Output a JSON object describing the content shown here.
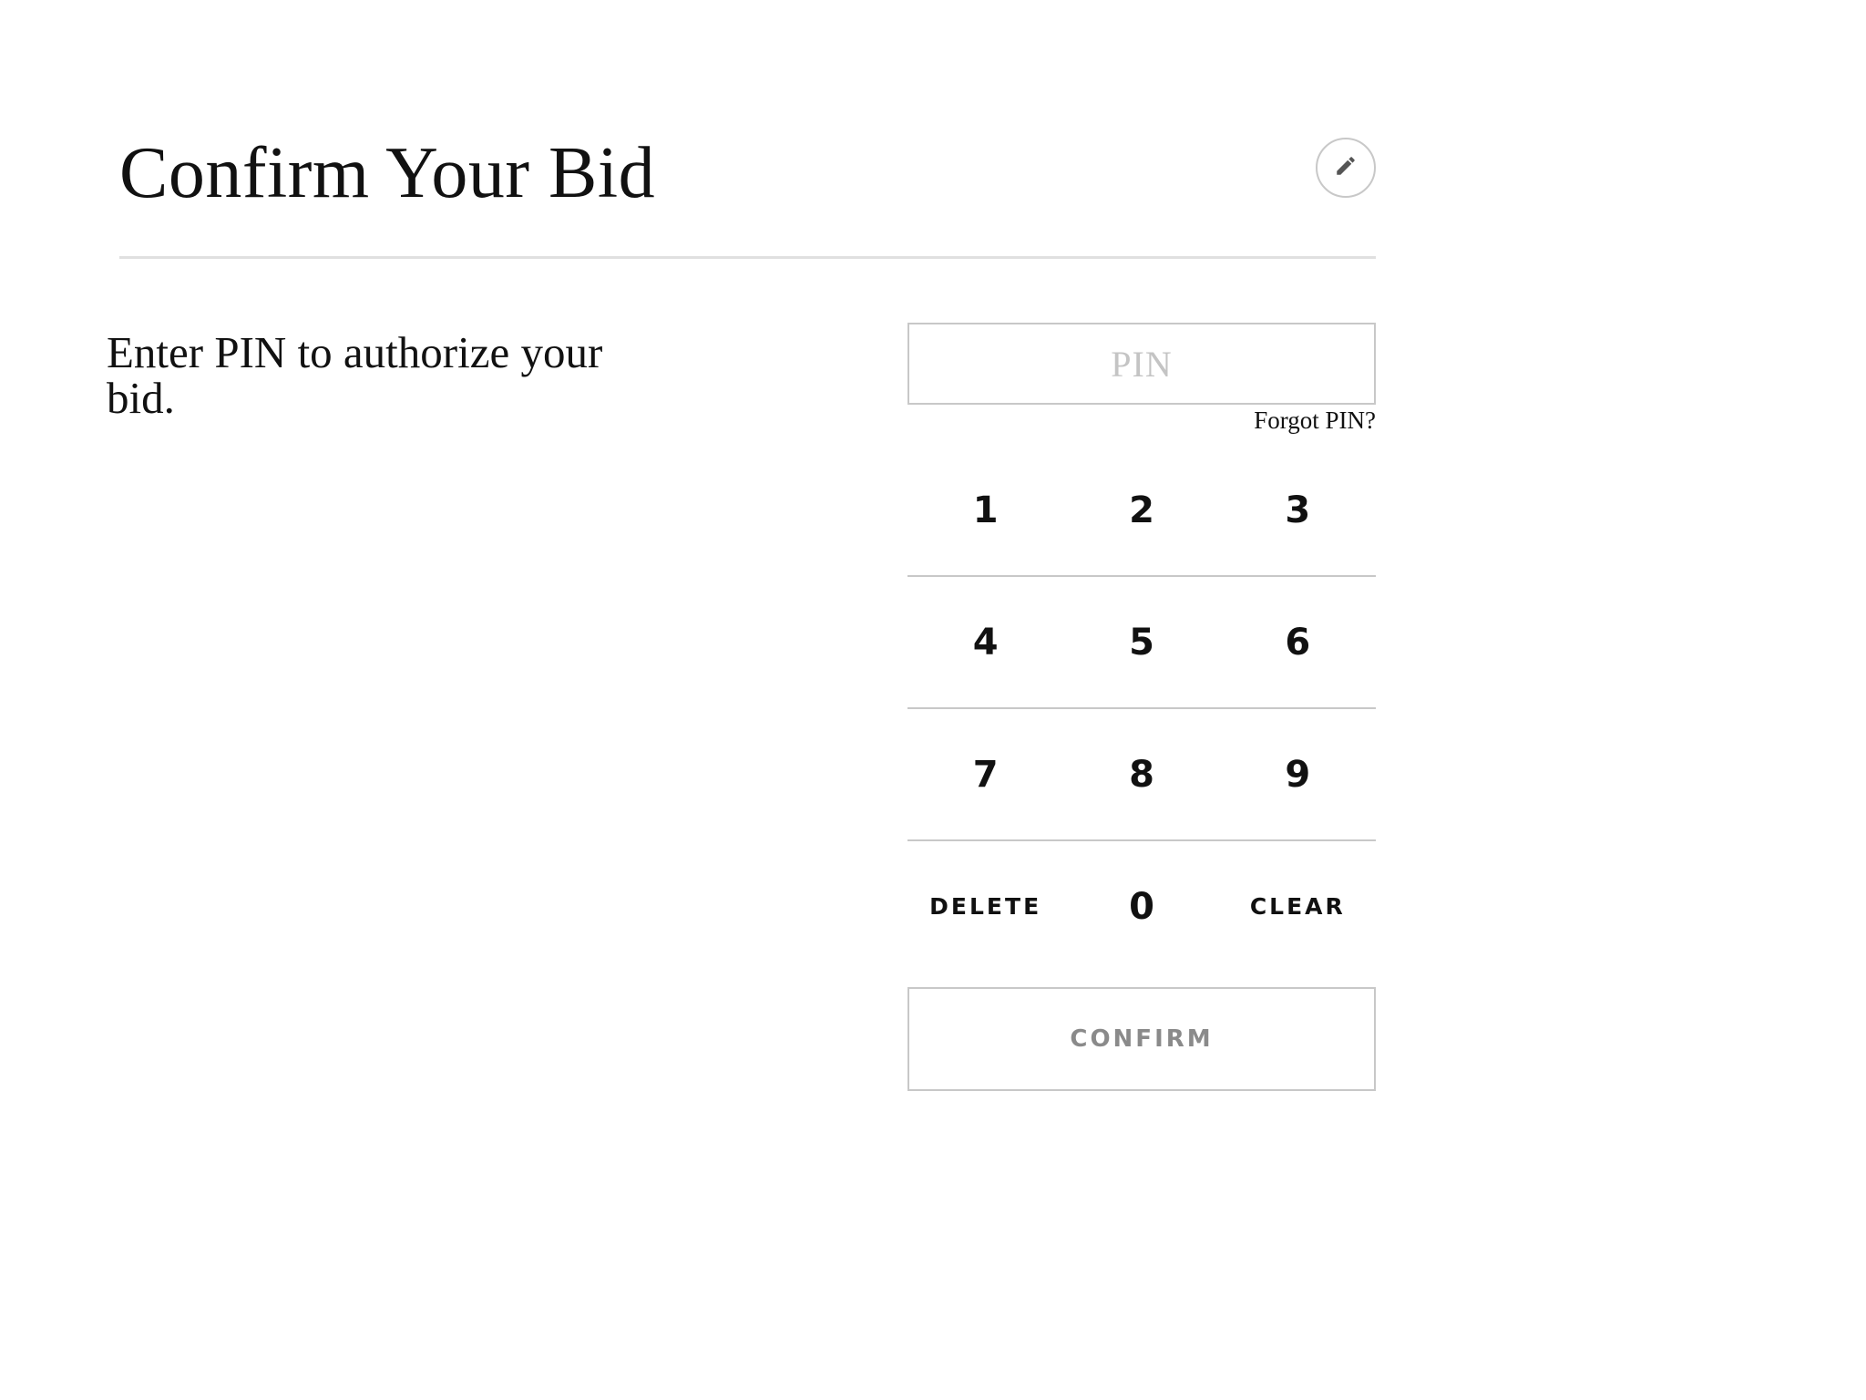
{
  "header": {
    "title": "Confirm Your Bid",
    "edit_icon": "pencil-icon"
  },
  "instruction": "Enter PIN to authorize your bid.",
  "pin": {
    "placeholder": "PIN",
    "value": "",
    "forgot_label": "Forgot PIN?"
  },
  "keypad": {
    "k1": "1",
    "k2": "2",
    "k3": "3",
    "k4": "4",
    "k5": "5",
    "k6": "6",
    "k7": "7",
    "k8": "8",
    "k9": "9",
    "delete": "DELETE",
    "k0": "0",
    "clear": "CLEAR"
  },
  "confirm_label": "CONFIRM",
  "colors": {
    "border": "#c8c8c8",
    "divider": "#e0e0e0",
    "text": "#111111",
    "disabled_text": "#8a8a8a",
    "placeholder": "#c4c4c4"
  }
}
